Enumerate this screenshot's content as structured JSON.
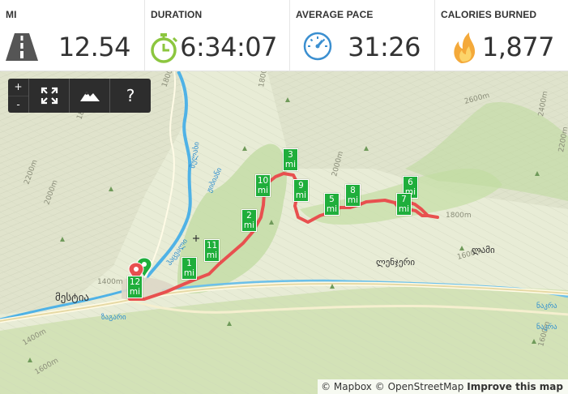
{
  "stats": [
    {
      "label": "MI",
      "value": "12.54",
      "icon": "road-icon"
    },
    {
      "label": "DURATION",
      "value": "6:34:07",
      "icon": "stopwatch-icon"
    },
    {
      "label": "AVERAGE PACE",
      "value": "31:26",
      "icon": "speedometer-icon"
    },
    {
      "label": "CALORIES BURNED",
      "value": "1,877",
      "icon": "flame-icon"
    }
  ],
  "colors": {
    "route": "#e8504f",
    "marker": "#1fae3b",
    "start_pin": "#1fae3b",
    "end_pin": "#e8504f",
    "river": "#4fb2e6"
  },
  "controls": {
    "zoom_in": "+",
    "zoom_out": "-",
    "help": "?"
  },
  "markers": [
    {
      "num": "1",
      "unit": "mi"
    },
    {
      "num": "2",
      "unit": "mi"
    },
    {
      "num": "3",
      "unit": "mi"
    },
    {
      "num": "5",
      "unit": "mi"
    },
    {
      "num": "6",
      "unit": "mi"
    },
    {
      "num": "7",
      "unit": "mi"
    },
    {
      "num": "8",
      "unit": "mi"
    },
    {
      "num": "9",
      "unit": "mi"
    },
    {
      "num": "10",
      "unit": "mi"
    },
    {
      "num": "11",
      "unit": "mi"
    },
    {
      "num": "12",
      "unit": "mi"
    }
  ],
  "places": {
    "mestia": "მესტია",
    "lenjeri": "ლენჯერი",
    "nakra": "ნაკრა",
    "zhibiani": "ჟიბიანი",
    "lami": "ლამი",
    "mulakhi": "მულახი",
    "zagari": "ზაგარი",
    "hatsvali": "ჰაცვალი",
    "sagazhi": "საგაზი"
  },
  "contours": [
    "1400m",
    "1600m",
    "1800m",
    "2000m",
    "2200m",
    "2400m",
    "2600m"
  ],
  "attribution": {
    "mapbox": "© Mapbox",
    "osm": "© OpenStreetMap",
    "improve": "Improve this map"
  }
}
